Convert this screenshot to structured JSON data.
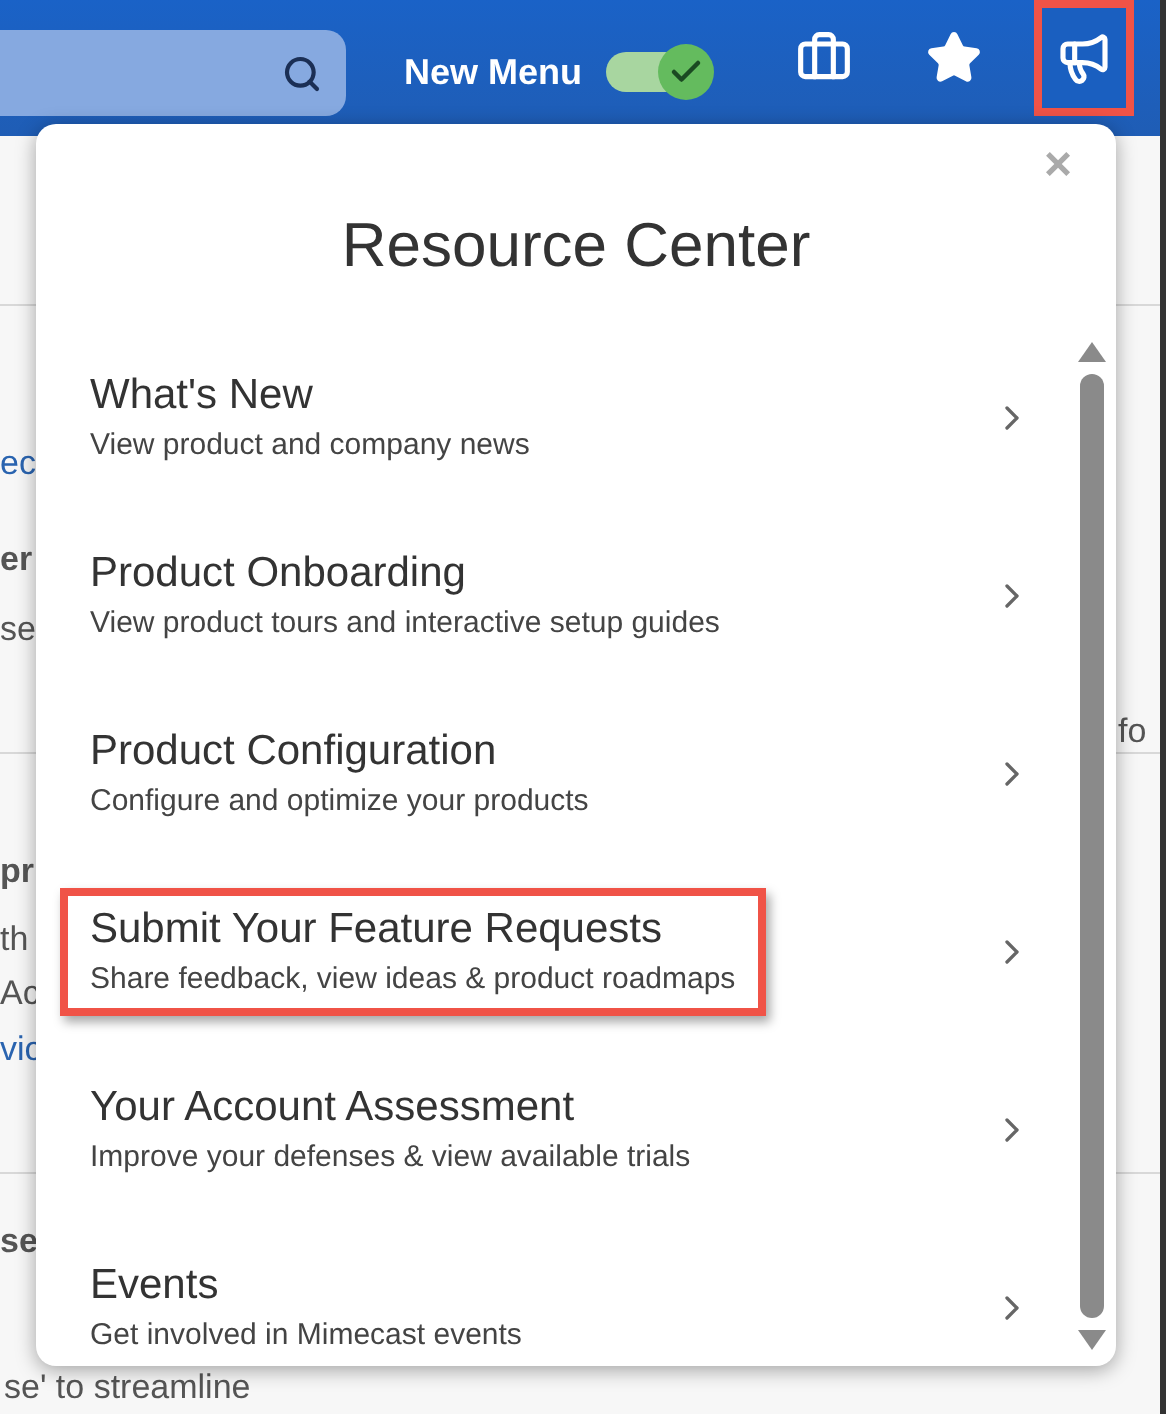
{
  "header": {
    "new_menu": {
      "label": "New Menu",
      "on": true
    },
    "icons": [
      {
        "kind": "briefcase",
        "highlighted": false
      },
      {
        "kind": "star",
        "highlighted": false
      },
      {
        "kind": "megaphone",
        "highlighted": true
      }
    ]
  },
  "background_texts": [
    {
      "text": "ec",
      "kind": "link"
    },
    {
      "text": "er",
      "kind": "bold"
    },
    {
      "text": "se",
      "kind": "plain"
    },
    {
      "text": "pr",
      "kind": "bold"
    },
    {
      "text": "th",
      "kind": "plain"
    },
    {
      "text": "Ac",
      "kind": "plain"
    },
    {
      "text": "vic",
      "kind": "link"
    },
    {
      "text": "se",
      "kind": "bold"
    },
    {
      "text": "se' to streamline",
      "kind": "plain"
    },
    {
      "text": "fo",
      "kind": "plain"
    }
  ],
  "resource_center": {
    "title": "Resource Center",
    "close": "×",
    "items": [
      {
        "title": "What's New",
        "subtitle": "View product and company news",
        "highlighted": false
      },
      {
        "title": "Product Onboarding",
        "subtitle": "View product tours and interactive setup guides",
        "highlighted": false
      },
      {
        "title": "Product Configuration",
        "subtitle": "Configure and optimize your products",
        "highlighted": false
      },
      {
        "title": "Submit Your Feature Requests",
        "subtitle": "Share feedback, view ideas & product roadmaps",
        "highlighted": true
      },
      {
        "title": "Your Account Assessment",
        "subtitle": "Improve your defenses & view available trials",
        "highlighted": false
      },
      {
        "title": "Events",
        "subtitle": "Get involved in Mimecast events",
        "highlighted": false
      }
    ]
  }
}
